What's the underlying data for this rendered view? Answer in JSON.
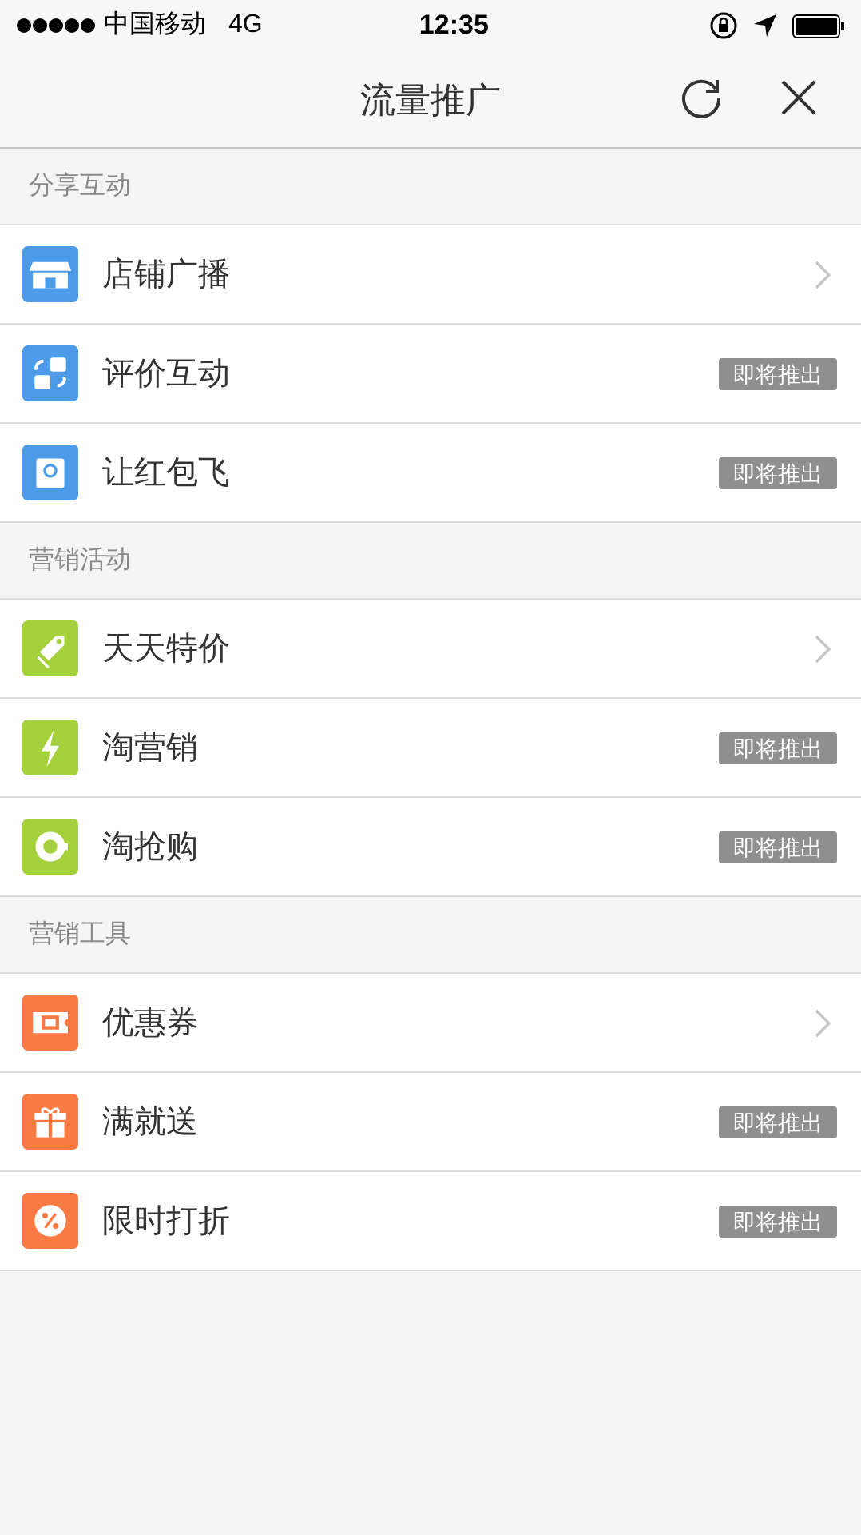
{
  "status_bar": {
    "carrier": "中国移动",
    "network": "4G",
    "time": "12:35"
  },
  "nav": {
    "title": "流量推广"
  },
  "sections": [
    {
      "title": "分享互动",
      "items": [
        {
          "label": "店铺广播",
          "color": "#4c9be8",
          "kind": "arrow"
        },
        {
          "label": "评价互动",
          "color": "#4c9be8",
          "kind": "badge",
          "badge": "即将推出"
        },
        {
          "label": "让红包飞",
          "color": "#4c9be8",
          "kind": "badge",
          "badge": "即将推出"
        }
      ]
    },
    {
      "title": "营销活动",
      "items": [
        {
          "label": "天天特价",
          "color": "#a5d23c",
          "kind": "arrow"
        },
        {
          "label": "淘营销",
          "color": "#a5d23c",
          "kind": "badge",
          "badge": "即将推出"
        },
        {
          "label": "淘抢购",
          "color": "#a5d23c",
          "kind": "badge",
          "badge": "即将推出"
        }
      ]
    },
    {
      "title": "营销工具",
      "items": [
        {
          "label": "优惠券",
          "color": "#f97a42",
          "kind": "arrow"
        },
        {
          "label": "满就送",
          "color": "#f97a42",
          "kind": "badge",
          "badge": "即将推出"
        },
        {
          "label": "限时打折",
          "color": "#f97a42",
          "kind": "badge",
          "badge": "即将推出"
        }
      ]
    }
  ]
}
